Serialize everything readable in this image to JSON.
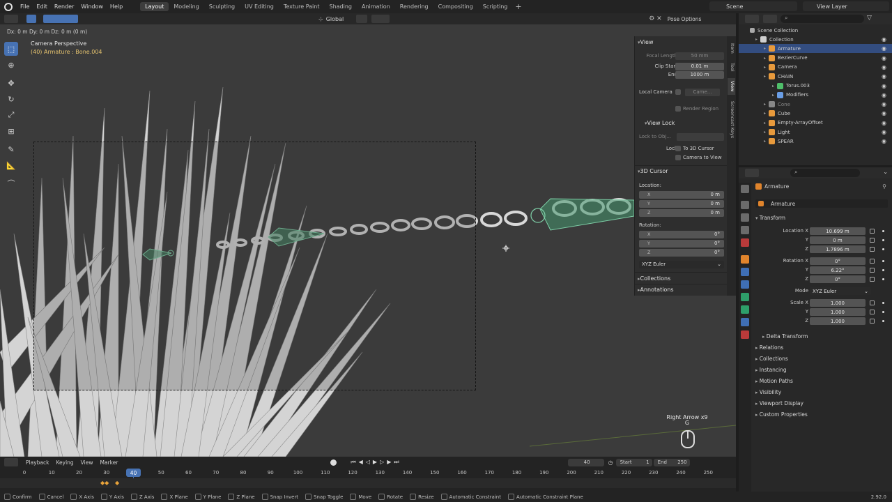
{
  "topbar": {
    "menus": [
      "File",
      "Edit",
      "Render",
      "Window",
      "Help"
    ],
    "workspaces": [
      "Layout",
      "Modeling",
      "Sculpting",
      "UV Editing",
      "Texture Paint",
      "Shading",
      "Animation",
      "Rendering",
      "Compositing",
      "Scripting"
    ],
    "active_workspace": "Layout",
    "scene": "Scene",
    "view_layer": "View Layer"
  },
  "viewport_header": {
    "orientation": "Global",
    "pose_options": "Pose Options",
    "status": "Dx: 0 m   Dy: 0 m   Dz: 0 m (0 m)"
  },
  "viewport": {
    "camera_title": "Camera Perspective",
    "camera_sub": "(40) Armature : Bone.004",
    "key_hint_1": "Right Arrow x9",
    "key_hint_2": "G"
  },
  "npanel": {
    "tabs": [
      "Item",
      "Tool",
      "View",
      "Screencast Keys"
    ],
    "active_tab": "View",
    "view_header": "View",
    "focal_length_label": "Focal Length",
    "focal_length": "50 mm",
    "clip_start_label": "Clip Start",
    "clip_start": "0.01 m",
    "end_label": "End",
    "end": "1000 m",
    "local_camera_label": "Local Camera",
    "local_camera": "Came...",
    "render_region": "Render Region",
    "view_lock_header": "View Lock",
    "lock_to_obj": "Lock to Obj...",
    "lock_label": "Lock",
    "to_3d_cursor": "To 3D Cursor",
    "camera_to_view": "Camera to View",
    "cursor_header": "3D Cursor",
    "location_label": "Location:",
    "loc_x": "0 m",
    "loc_y": "0 m",
    "loc_z": "0 m",
    "rotation_label": "Rotation:",
    "rot_x": "0°",
    "rot_y": "0°",
    "rot_z": "0°",
    "rot_mode": "XYZ Euler",
    "collections": "Collections",
    "annotations": "Annotations",
    "x": "X",
    "y": "Y",
    "z": "Z"
  },
  "timeline": {
    "menus": [
      "Playback",
      "Keying",
      "View",
      "Marker"
    ],
    "ticks": [
      "0",
      "10",
      "20",
      "30",
      "40",
      "50",
      "60",
      "70",
      "80",
      "90",
      "100",
      "110",
      "120",
      "130",
      "140",
      "150",
      "160",
      "170",
      "180",
      "190",
      "200",
      "210",
      "220",
      "230",
      "240",
      "250"
    ],
    "current_frame": "40",
    "start_label": "Start",
    "start": "1",
    "end_label": "End",
    "end": "250"
  },
  "statusbar": {
    "items": [
      "Confirm",
      "Cancel",
      "X Axis",
      "Y Axis",
      "Z Axis",
      "X Plane",
      "Y Plane",
      "Z Plane",
      "Snap Invert",
      "Snap Toggle",
      "Move",
      "Rotate",
      "Resize",
      "Automatic Constraint",
      "Automatic Constraint Plane"
    ],
    "version": "2.92.0"
  },
  "outliner": {
    "root": "Scene Collection",
    "items": [
      {
        "name": "Collection",
        "indent": 0,
        "color": "#cfcfcf"
      },
      {
        "name": "Armature",
        "indent": 1,
        "color": "#e89a3c",
        "selected": true
      },
      {
        "name": "BezierCurve",
        "indent": 1,
        "color": "#e89a3c"
      },
      {
        "name": "Camera",
        "indent": 1,
        "color": "#e89a3c"
      },
      {
        "name": "CHAIN",
        "indent": 1,
        "color": "#e89a3c"
      },
      {
        "name": "Torus.003",
        "indent": 2,
        "color": "#4fbf6a"
      },
      {
        "name": "Modifiers",
        "indent": 2,
        "color": "#6a9ee6"
      },
      {
        "name": "Cone",
        "indent": 1,
        "color": "#888888"
      },
      {
        "name": "Cube",
        "indent": 1,
        "color": "#e89a3c"
      },
      {
        "name": "Empty-ArrayOffset",
        "indent": 1,
        "color": "#e89a3c"
      },
      {
        "name": "Light",
        "indent": 1,
        "color": "#e89a3c"
      },
      {
        "name": "SPEAR",
        "indent": 1,
        "color": "#e89a3c"
      }
    ]
  },
  "properties": {
    "object_name": "Armature",
    "object_field": "Armature",
    "transform": "Transform",
    "location_x_label": "Location X",
    "location_x": "10.699 m",
    "location_y": "0 m",
    "location_z": "1.7896 m",
    "rotation_x_label": "Rotation X",
    "rotation_x": "0°",
    "rotation_y": "6.22°",
    "rotation_z": "0°",
    "mode_label": "Mode",
    "mode": "XYZ Euler",
    "scale_x_label": "Scale X",
    "scale_x": "1.000",
    "scale_y": "1.000",
    "scale_z": "1.000",
    "delta_transform": "Delta Transform",
    "panels": [
      "Relations",
      "Collections",
      "Instancing",
      "Motion Paths",
      "Visibility",
      "Viewport Display",
      "Custom Properties"
    ],
    "y": "Y",
    "z": "Z"
  }
}
